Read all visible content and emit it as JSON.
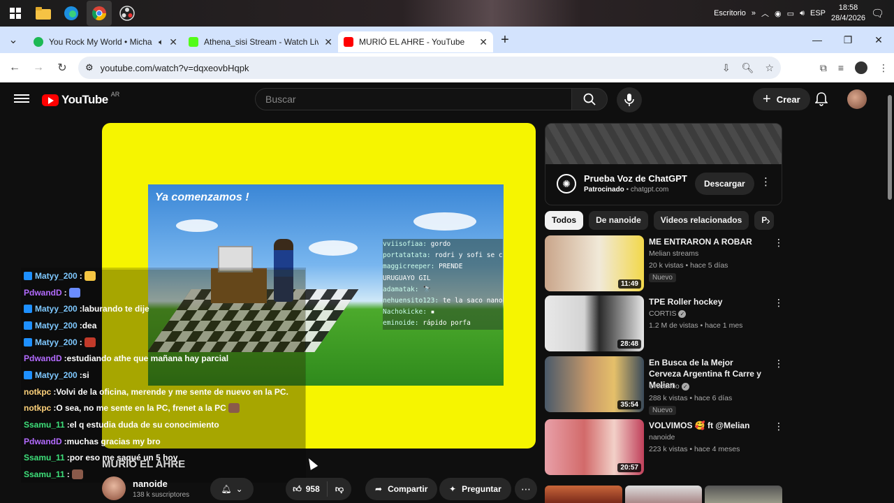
{
  "taskbar": {
    "desktop_label": "Escritorio",
    "language": "ESP",
    "time": "18:58",
    "date": "28/4/2026"
  },
  "tabs": [
    {
      "title": "You Rock My World • Micha",
      "favicon_color": "#1db954",
      "audio": true
    },
    {
      "title": "Athena_sisi Stream - Watch Live",
      "favicon_color": "#53fc18",
      "audio": false
    },
    {
      "title": "MURIÓ EL AHRE - YouTube",
      "favicon_color": "#ff0000",
      "audio": false
    }
  ],
  "address": {
    "url": "youtube.com/watch?v=dqxeovbHqpk"
  },
  "yt": {
    "logo": "YouTube",
    "country": "AR",
    "search_placeholder": "Buscar",
    "create_label": "Crear"
  },
  "player": {
    "screen_title": "Ya comenzamos !",
    "ingame_chat": [
      {
        "user": "vviisofiaa:",
        "msg": "gordo"
      },
      {
        "user": "portatatata:",
        "msg": "rodri y sofi se cojen"
      },
      {
        "user": "maggicreeper:",
        "msg": "PRENDE"
      },
      {
        "user": "",
        "msg": "URUGUAYO GIL"
      },
      {
        "user": "adamatak:",
        "msg": "🔭"
      },
      {
        "user": "nehuensito123:",
        "msg": "te la saco nano?"
      },
      {
        "user": "Nachokicke:",
        "msg": "▪"
      },
      {
        "user": "eminoide:",
        "msg": "rápido porfa"
      }
    ]
  },
  "stream_chat": [
    {
      "user": "Matyy_200",
      "color": "#7ec8ff",
      "badge": true,
      "msg": "",
      "emote": "#f5c542"
    },
    {
      "user": "PdwandD",
      "color": "#b36bff",
      "badge": false,
      "msg": "",
      "emote": "#6a8cff"
    },
    {
      "user": "Matyy_200",
      "color": "#7ec8ff",
      "badge": true,
      "msg": "laburando te dije",
      "emote": ""
    },
    {
      "user": "Matyy_200",
      "color": "#7ec8ff",
      "badge": true,
      "msg": "dea",
      "emote": ""
    },
    {
      "user": "Matyy_200",
      "color": "#7ec8ff",
      "badge": true,
      "msg": "",
      "emote": "#c23a2a"
    },
    {
      "user": "PdwandD",
      "color": "#b36bff",
      "badge": false,
      "msg": "estudiando athe que mañana hay parcial",
      "emote": ""
    },
    {
      "user": "Matyy_200",
      "color": "#7ec8ff",
      "badge": true,
      "msg": "si",
      "emote": ""
    },
    {
      "user": "notkpc",
      "color": "#ffd27a",
      "badge": false,
      "msg": "Volvi de la oficina, merende y me sente de nuevo en la PC.",
      "emote": ""
    },
    {
      "user": "notkpc",
      "color": "#ffd27a",
      "badge": false,
      "msg": "O sea, no me sente en la PC, frenet a la PC",
      "emote": "#8a5a4a"
    },
    {
      "user": "Ssamu_11",
      "color": "#3ee07a",
      "badge": false,
      "msg": "el q estudia duda de su conocimiento",
      "emote": ""
    },
    {
      "user": "PdwandD",
      "color": "#b36bff",
      "badge": false,
      "msg": "muchas gracias my bro",
      "emote": ""
    },
    {
      "user": "Ssamu_11",
      "color": "#3ee07a",
      "badge": false,
      "msg": "por eso me saqué un 5 hoy",
      "emote": ""
    },
    {
      "user": "Ssamu_11",
      "color": "#3ee07a",
      "badge": false,
      "msg": "",
      "emote": "#8a5a4a"
    }
  ],
  "video": {
    "title": "MURIÓ EL AHRE",
    "channel": "nanoide",
    "subscribers": "138 k suscriptores",
    "likes": "958",
    "share_label": "Compartir",
    "ask_label": "Preguntar"
  },
  "ad": {
    "title": "Prueba Voz de ChatGPT",
    "sponsored": "Patrocinado",
    "domain": "chatgpt.com",
    "cta": "Descargar"
  },
  "chips": [
    "Todos",
    "De nanoide",
    "Videos relacionados",
    "P"
  ],
  "recommendations": [
    {
      "title": "ME ENTRARON A ROBAR",
      "channel": "Melian streams",
      "meta": "20 k vistas • hace 5 días",
      "badge": "Nuevo",
      "duration": "11:49",
      "verified": false,
      "thumb": "linear-gradient(90deg,#c9a58a,#f1e9d8 55%,#f2d84a)"
    },
    {
      "title": "TPE Roller hockey",
      "channel": "CORTIS",
      "meta": "1.2 M de vistas • hace 1 mes",
      "badge": "",
      "duration": "28:48",
      "verified": true,
      "thumb": "linear-gradient(90deg,#e8e8e8,#d4d4d4 40%,#2a2a2a 55%,#e6e6e6)"
    },
    {
      "title": "En Busca de la Mejor Cerveza Argentina ft Carre y Melian",
      "channel": "Unicomio",
      "meta": "288 k vistas • hace 6 días",
      "badge": "Nuevo",
      "duration": "35:54",
      "verified": true,
      "thumb": "linear-gradient(90deg,#4a5a6a,#c99a6a 45%,#e5c06a 70%,#3a4a5a)"
    },
    {
      "title": "VOLVIMOS 🥰 ft @Melian",
      "channel": "nanoide",
      "meta": "223 k vistas • hace 4 meses",
      "badge": "",
      "duration": "20:57",
      "verified": false,
      "thumb": "linear-gradient(90deg,#e8a0a8,#d26a6a 40%,#f2d0c8 70%,#c0405a)"
    }
  ]
}
